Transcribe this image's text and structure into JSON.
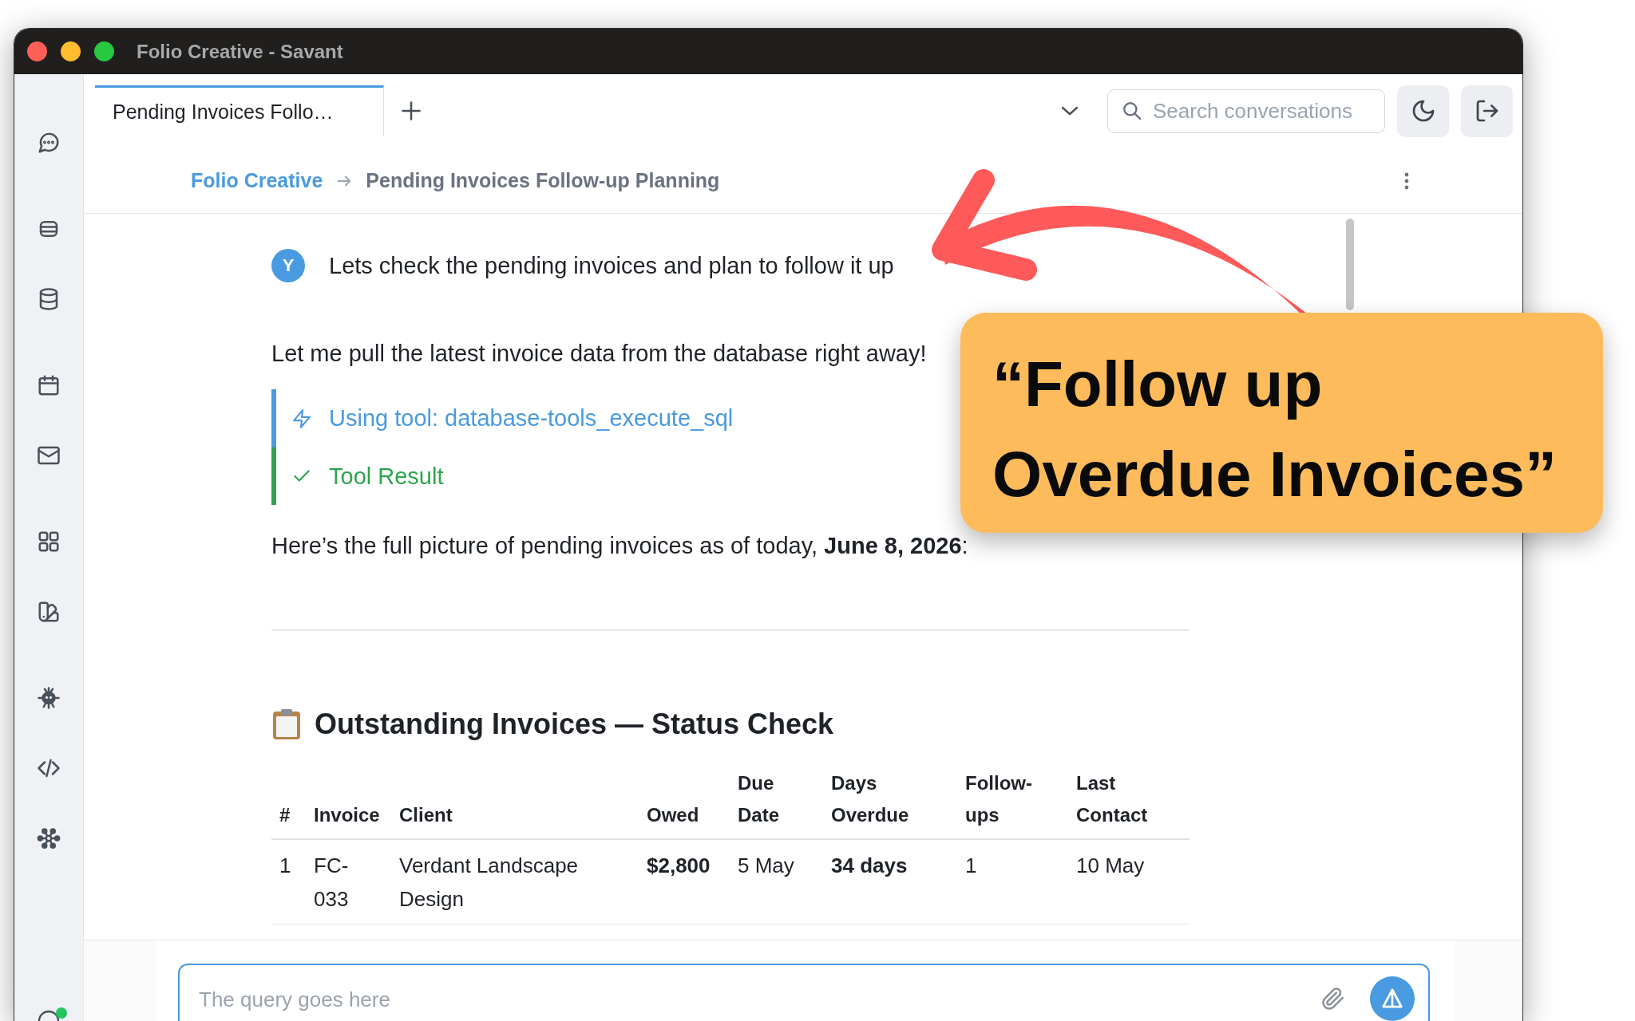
{
  "window": {
    "title": "Folio Creative - Savant"
  },
  "sidebar": {
    "account": {
      "online": true
    }
  },
  "tabs": [
    {
      "label": "Pending Invoices Follo…",
      "selected": true
    }
  ],
  "search": {
    "placeholder": "Search conversations"
  },
  "breadcrumb": [
    {
      "label": "Folio Creative",
      "kind": "link"
    },
    {
      "label": "Pending Invoices Follow-up Planning",
      "kind": "current"
    }
  ],
  "messages": [
    {
      "kind": "user",
      "avatar": "Y",
      "text": "Lets check the pending invoices and plan to follow it up"
    },
    {
      "kind": "text",
      "text": "Let me pull the latest invoice data from the database right away!"
    },
    {
      "kind": "tool_call",
      "text": "Using tool: database-tools_execute_sql"
    },
    {
      "kind": "tool_result",
      "text": "Tool Result"
    },
    {
      "kind": "text",
      "text": "Here’s the full picture of pending invoices as of today, **June 8, 2026**:"
    },
    {
      "kind": "rule"
    },
    {
      "kind": "heading",
      "text": "Outstanding Invoices — Status Check"
    },
    {
      "kind": "table",
      "columns": [
        {
          "label": "#"
        },
        {
          "label": "Invoice"
        },
        {
          "label": "Client"
        },
        {
          "label": "Owed",
          "bold": true
        },
        {
          "label": "Due Date"
        },
        {
          "label": "Days Overdue",
          "bold": true
        },
        {
          "label": "Follow-ups"
        },
        {
          "label": "Last Contact"
        }
      ],
      "rows": [
        [
          "1",
          "FC-033",
          "Verdant Landscape Design",
          "$2,800",
          "5 May",
          "34 days",
          "1",
          "10 May"
        ]
      ]
    }
  ],
  "composer": {
    "placeholder": "The query goes here"
  },
  "callout": {
    "text": "“Follow up Overdue Invoices”"
  }
}
